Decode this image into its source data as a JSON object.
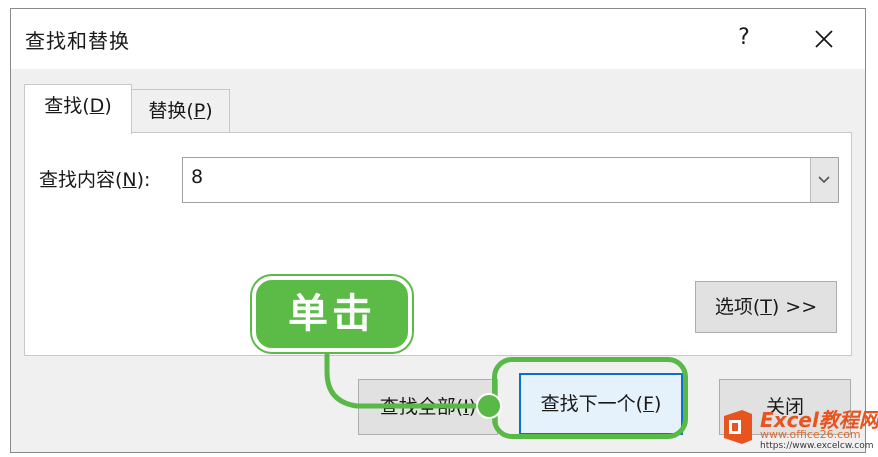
{
  "dialog": {
    "title": "查找和替换",
    "help_label": "?",
    "tabs": [
      {
        "label_prefix": "查找(",
        "mnemonic": "D",
        "label_suffix": ")"
      },
      {
        "label_prefix": "替换(",
        "mnemonic": "P",
        "label_suffix": ")"
      }
    ],
    "find": {
      "label_prefix": "查找内容(",
      "mnemonic": "N",
      "label_suffix": "):",
      "value": "8"
    },
    "buttons": {
      "options": {
        "label_prefix": "选项(",
        "mnemonic": "T",
        "label_suffix": ") >>"
      },
      "find_all": {
        "label_prefix": "查找全部(",
        "mnemonic": "I",
        "label_suffix": ")"
      },
      "find_next": {
        "label_prefix": "查找下一个(",
        "mnemonic": "F",
        "label_suffix": ")"
      },
      "close": {
        "label": "关闭"
      }
    }
  },
  "annotation": {
    "callout_text": "单击",
    "color": "#5bbb46"
  },
  "watermark": {
    "brand": "Excel教程网",
    "url_primary": "www.office26.com",
    "url_secondary": "https://www.excelcw.com"
  },
  "colors": {
    "accent_blue": "#0a6fd1",
    "highlight_green": "#58b947",
    "watermark_orange": "#e8541f"
  }
}
